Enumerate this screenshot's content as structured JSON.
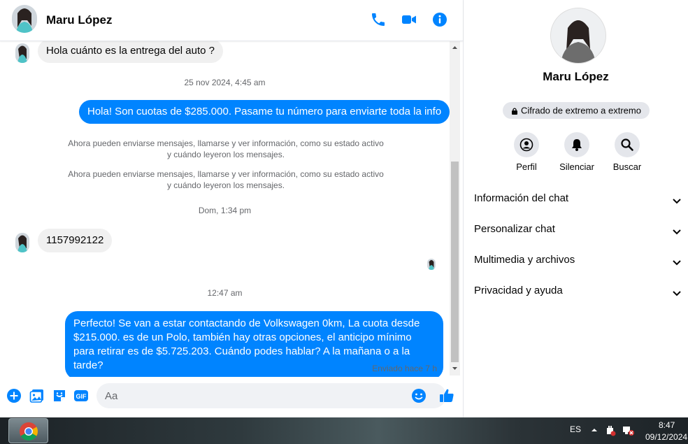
{
  "header": {
    "contact_name": "Maru López"
  },
  "messages": {
    "m1": "Hola cuánto es la entrega del auto ?",
    "ts1": "25 nov 2024, 4:45 am",
    "m2": "Hola! Son cuotas de $285.000. Pasame tu número para enviarte toda la info",
    "sys1": "Ahora pueden enviarse mensajes, llamarse y ver información, como su estado activo y cuándo leyeron los mensajes.",
    "sys2": "Ahora pueden enviarse mensajes, llamarse y ver información, como su estado activo y cuándo leyeron los mensajes.",
    "ts2": "Dom, 1:34 pm",
    "m3": "1157992122",
    "ts3": "12:47 am",
    "m4": "Perfecto!  Se van a estar contactando de Volkswagen 0km, La cuota desde $215.000. es de un Polo, también hay otras opciones, el anticipo mínimo para retirar es de $5.725.203. Cuándo podes hablar? A la mañana o a la tarde?",
    "status": "Enviado hace 7 h"
  },
  "composer": {
    "placeholder": "Aa"
  },
  "info": {
    "name": "Maru López",
    "encryption": "Cifrado de extremo a extremo",
    "actions": [
      "Perfil",
      "Silenciar",
      "Buscar"
    ],
    "sections": [
      "Información del chat",
      "Personalizar chat",
      "Multimedia y archivos",
      "Privacidad y ayuda"
    ]
  },
  "taskbar": {
    "language": "ES",
    "time": "8:47",
    "date": "09/12/2024"
  },
  "colors": {
    "accent": "#0084ff",
    "incoming_bubble": "#f0f0f0",
    "muted_text": "#65676b"
  }
}
